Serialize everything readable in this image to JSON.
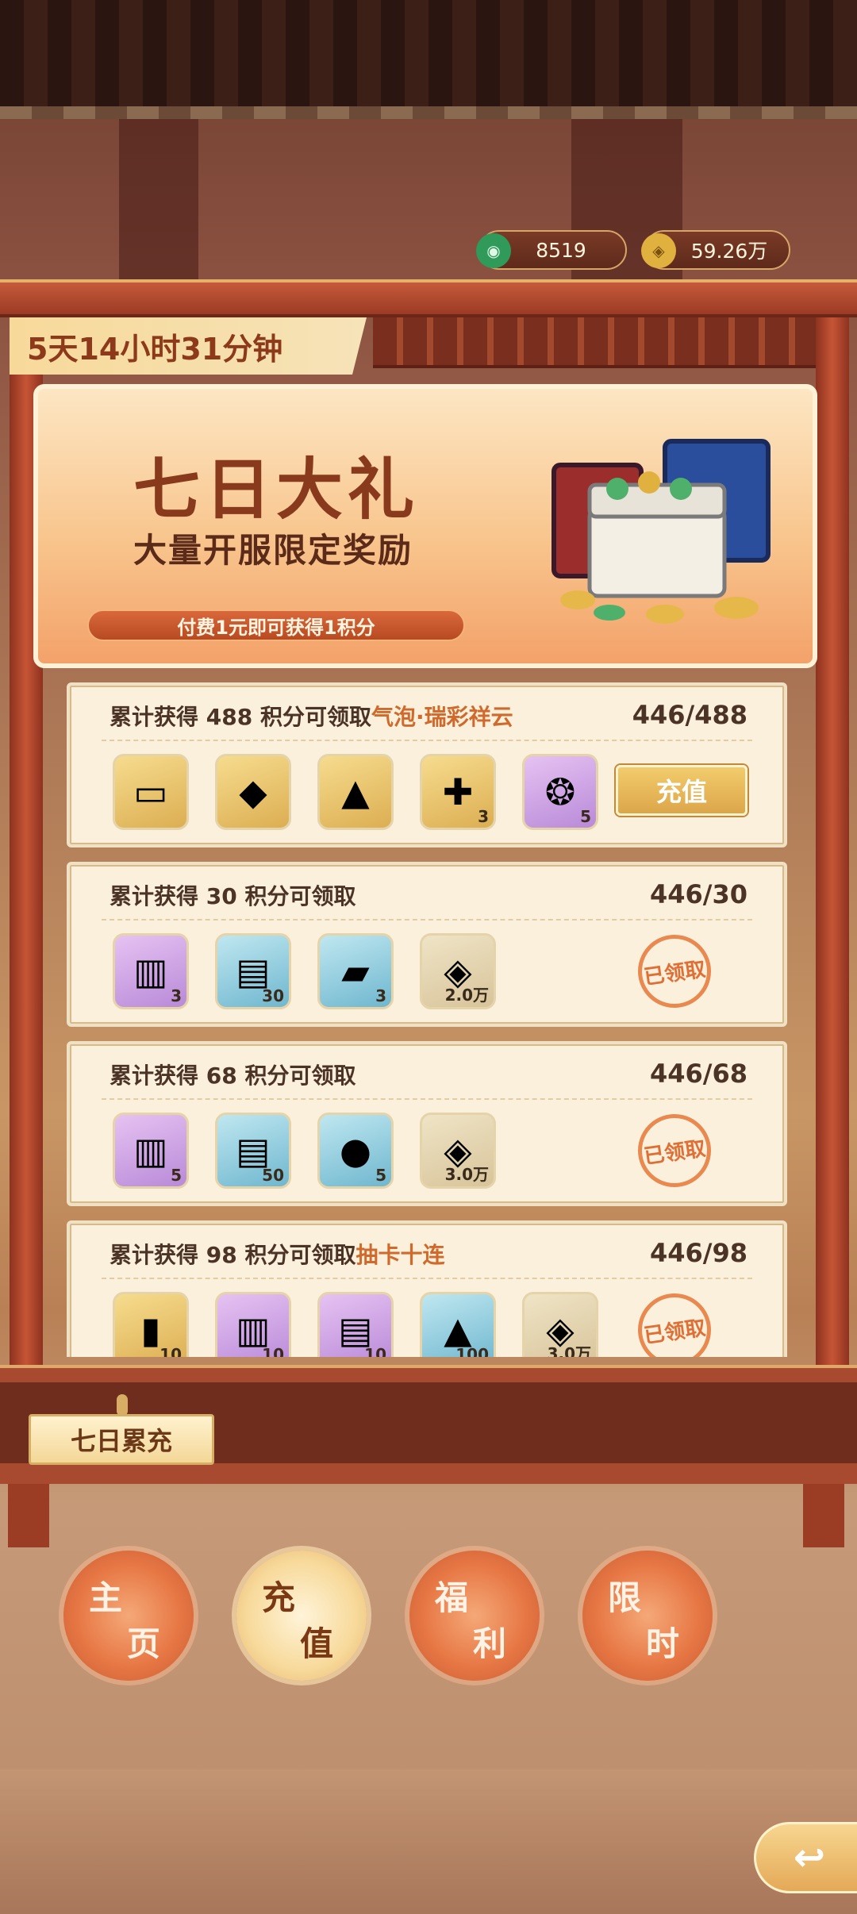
{
  "header": {
    "currency_jade": {
      "value": "8519",
      "icon": "jade-coin-icon"
    },
    "currency_coin": {
      "value": "59.26万",
      "icon": "copper-coin-icon"
    }
  },
  "timer": "5天14小时31分钟",
  "banner": {
    "title": "七日大礼",
    "subtitle": "大量开服限定奖励",
    "note": "付费1元即可获得1积分"
  },
  "tasks": [
    {
      "label": "累计获得 488 积分可领取",
      "highlight": "气泡·瑞彩祥云",
      "progress": "446/488",
      "items": [
        {
          "icon": "scroll-frame-icon",
          "quality": "gold",
          "count": ""
        },
        {
          "icon": "crystal-icon",
          "quality": "gold",
          "count": ""
        },
        {
          "icon": "tent-icon",
          "quality": "gold",
          "count": ""
        },
        {
          "icon": "puzzle-block-icon",
          "quality": "gold",
          "count": "3"
        },
        {
          "icon": "treasure-pot-icon",
          "quality": "purple",
          "count": "5"
        }
      ],
      "action": "充值"
    },
    {
      "label": "累计获得 30 积分可领取",
      "highlight": "",
      "progress": "446/30",
      "items": [
        {
          "icon": "juice-jar-icon",
          "quality": "purple",
          "count": "3"
        },
        {
          "icon": "paper-stack-icon",
          "quality": "blue",
          "count": "30"
        },
        {
          "icon": "ticket-icon",
          "quality": "blue",
          "count": "3"
        },
        {
          "icon": "copper-coin-icon",
          "quality": "plain",
          "count": "2.0万"
        }
      ],
      "action": "已领取"
    },
    {
      "label": "累计获得 68 积分可领取",
      "highlight": "",
      "progress": "446/68",
      "items": [
        {
          "icon": "juice-jar-icon",
          "quality": "purple",
          "count": "5"
        },
        {
          "icon": "paper-stack-icon",
          "quality": "blue",
          "count": "50"
        },
        {
          "icon": "cat-coin-icon",
          "quality": "blue",
          "count": "5"
        },
        {
          "icon": "copper-coin-icon",
          "quality": "plain",
          "count": "3.0万"
        }
      ],
      "action": "已领取"
    },
    {
      "label": "累计获得 98 积分可领取",
      "highlight": "抽卡十连",
      "progress": "446/98",
      "items": [
        {
          "icon": "red-card-icon",
          "quality": "gold",
          "count": "10"
        },
        {
          "icon": "juice-jar-icon",
          "quality": "purple",
          "count": "10"
        },
        {
          "icon": "book-icon",
          "quality": "purple",
          "count": "10"
        },
        {
          "icon": "sand-pile-icon",
          "quality": "blue",
          "count": "100"
        },
        {
          "icon": "copper-coin-icon",
          "quality": "plain",
          "count": "3.0万"
        }
      ],
      "action": "已领取"
    }
  ],
  "section_tab": "七日累充",
  "nav": [
    {
      "c1": "主",
      "c2": "页"
    },
    {
      "c1": "充",
      "c2": "值"
    },
    {
      "c1": "福",
      "c2": "利"
    },
    {
      "c1": "限",
      "c2": "时"
    }
  ],
  "back_icon": "back-arrow-icon"
}
